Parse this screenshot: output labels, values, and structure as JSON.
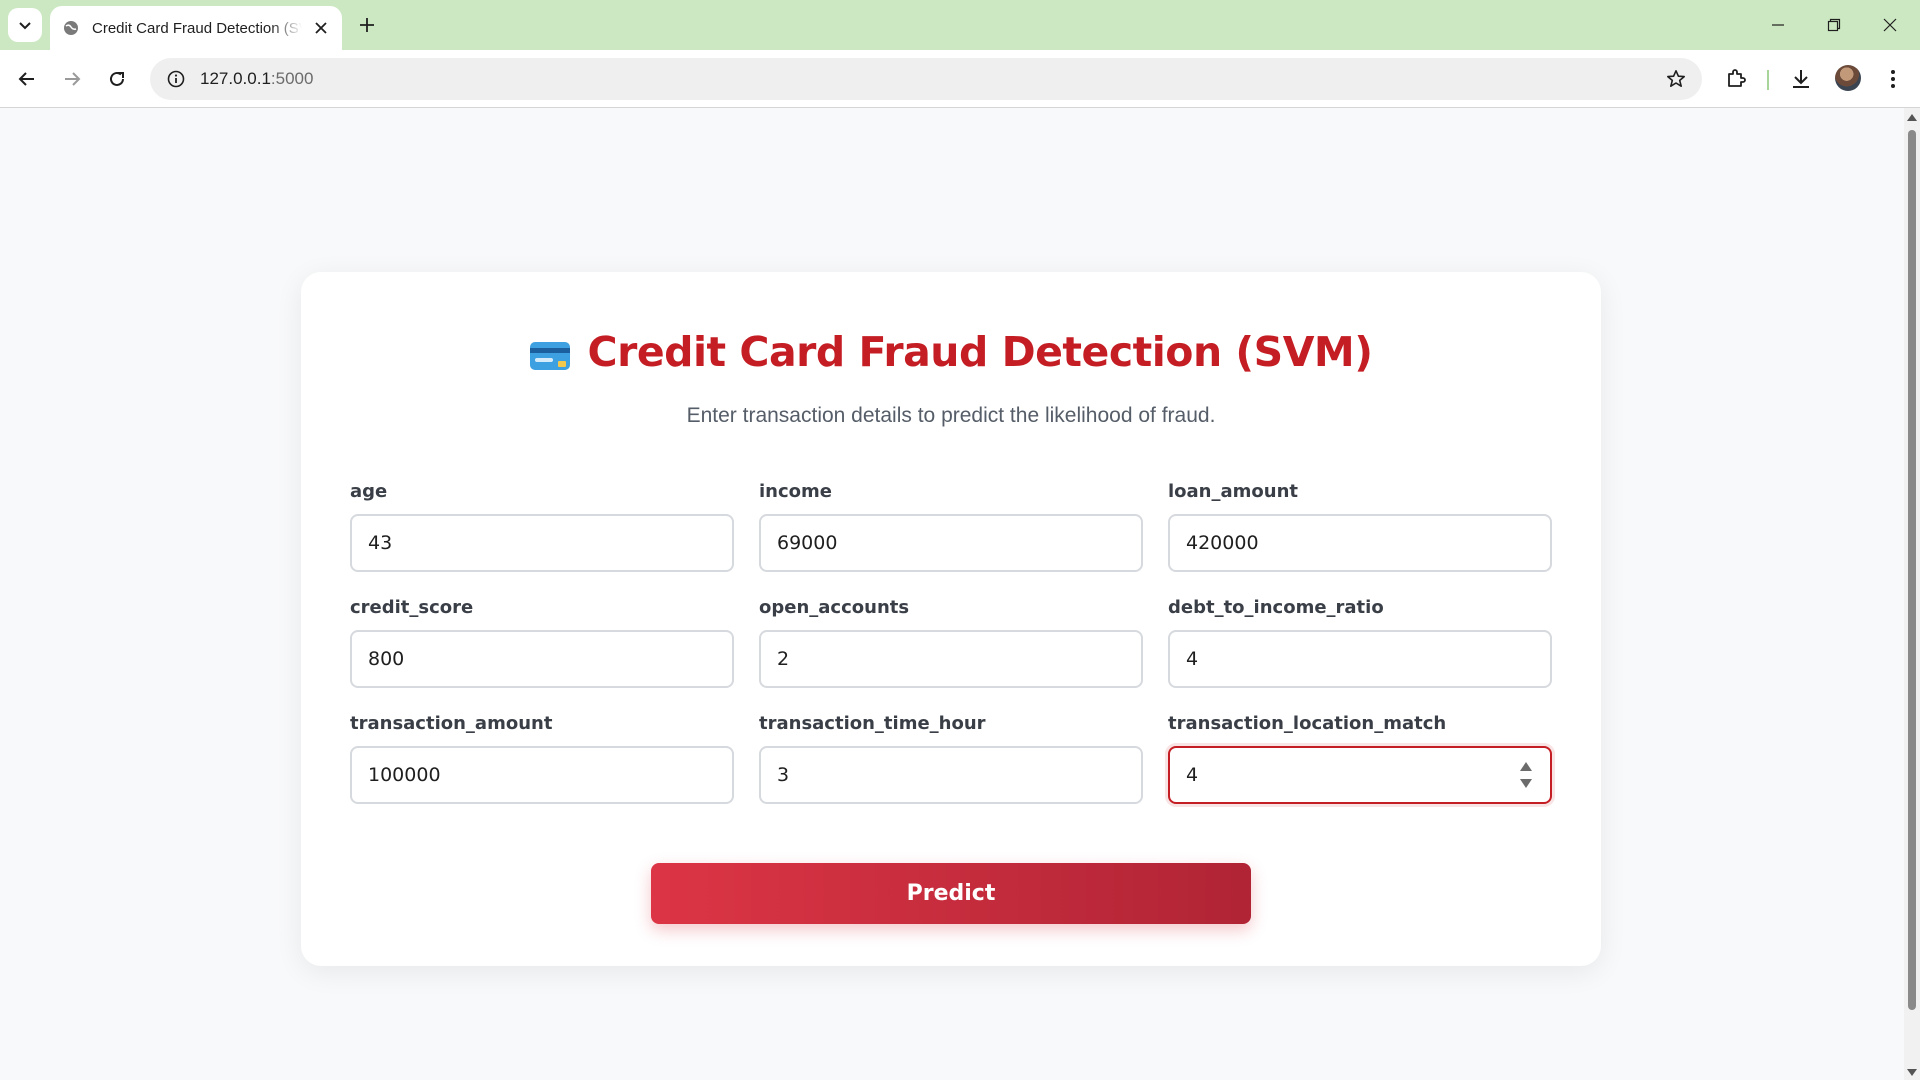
{
  "browser": {
    "tab_title": "Credit Card Fraud Detection (SVM)",
    "url_host": "127.0.0.1",
    "url_port": ":5000",
    "icons": [
      "tab-search-icon",
      "globe-icon",
      "close-icon",
      "plus-icon",
      "minimize-icon",
      "restore-icon",
      "close-window-icon",
      "back-icon",
      "forward-icon",
      "reload-icon",
      "info-icon",
      "star-icon",
      "extensions-icon",
      "download-icon",
      "menu-icon"
    ],
    "theme_color": "#cce8c2"
  },
  "page": {
    "title": "Credit Card Fraud Detection (SVM)",
    "subtitle": "Enter transaction details to predict the likelihood of fraud.",
    "title_color": "#c41e24",
    "fields": [
      {
        "label": "age",
        "value": "43"
      },
      {
        "label": "income",
        "value": "69000"
      },
      {
        "label": "loan_amount",
        "value": "420000"
      },
      {
        "label": "credit_score",
        "value": "800"
      },
      {
        "label": "open_accounts",
        "value": "2"
      },
      {
        "label": "debt_to_income_ratio",
        "value": "4"
      },
      {
        "label": "transaction_amount",
        "value": "100000"
      },
      {
        "label": "transaction_time_hour",
        "value": "3"
      },
      {
        "label": "transaction_location_match",
        "value": "4"
      }
    ],
    "button_label": "Predict",
    "button_color": "#dc3545"
  }
}
